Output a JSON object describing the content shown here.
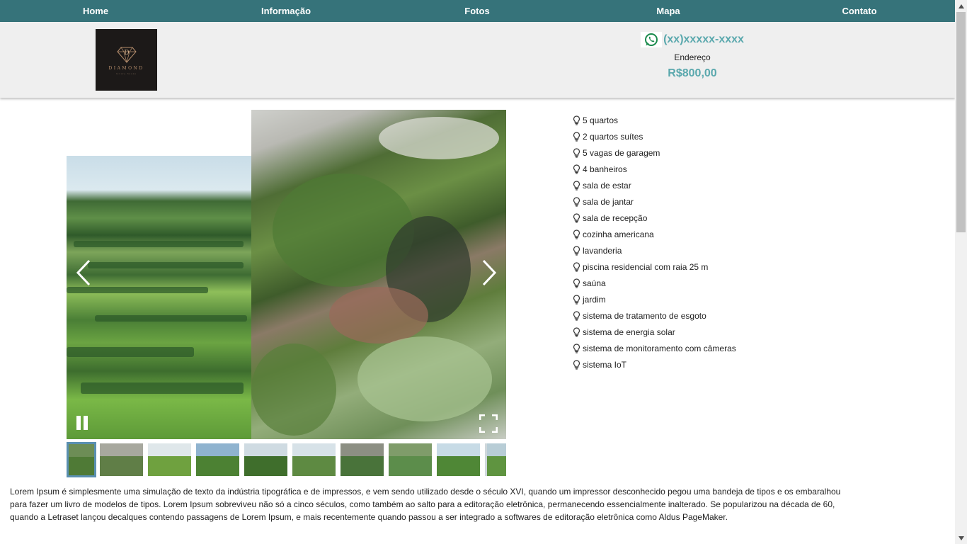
{
  "nav": {
    "items": [
      {
        "label": "Home"
      },
      {
        "label": "Informação"
      },
      {
        "label": "Fotos"
      },
      {
        "label": "Mapa"
      },
      {
        "label": "Contato"
      }
    ]
  },
  "header": {
    "logo": {
      "brand": "DIAMOND",
      "subtitle": "luxury house"
    },
    "phone": "(xx)xxxxx-xxxx",
    "address": "Endereço",
    "price": "R$800,00"
  },
  "gallery": {
    "prev_icon": "chevron-left-icon",
    "next_icon": "chevron-right-icon",
    "pause_icon": "pause-icon",
    "fullscreen_icon": "fullscreen-icon",
    "thumbnail_count": 10,
    "active_thumbnail": 1
  },
  "features": [
    "5 quartos",
    "2 quartos suítes",
    "5 vagas de garagem",
    "4 banheiros",
    "sala de estar",
    "sala de jantar",
    "sala de recepção",
    "cozinha americana",
    "lavanderia",
    "piscina residencial com raia 25 m",
    "saúna",
    "jardim",
    "sistema de tratamento de esgoto",
    "sistema de energia solar",
    "sistema de monitoramento com câmeras",
    "sistema IoT"
  ],
  "description": "Lorem Ipsum é simplesmente uma simulação de texto da indústria tipográfica e de impressos, e vem sendo utilizado desde o século XVI, quando um impressor desconhecido pegou uma bandeja de tipos e os embaralhou para fazer um livro de modelos de tipos. Lorem Ipsum sobreviveu não só a cinco séculos, como também ao salto para a editoração eletrônica, permanecendo essencialmente inalterado. Se popularizou na década de 60, quando a Letraset lançou decalques contendo passagens de Lorem Ipsum, e mais recentemente quando passou a ser integrado a softwares de editoração eletrônica como Aldus PageMaker.",
  "colors": {
    "nav_bg": "#36737a",
    "accent": "#5aa8ad",
    "header_bg": "#efefef",
    "whatsapp": "#1a8a4c"
  }
}
